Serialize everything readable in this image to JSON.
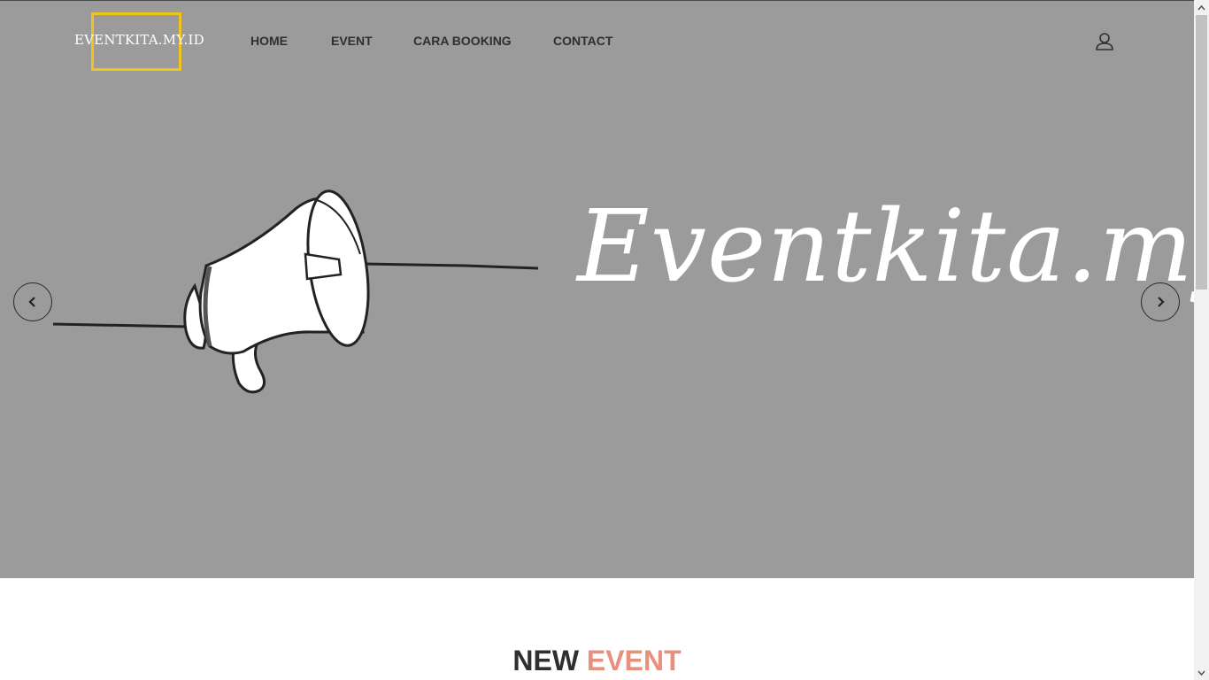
{
  "header": {
    "logo_text": "EVENTKITA.MY.ID",
    "nav": [
      {
        "label": "HOME"
      },
      {
        "label": "EVENT"
      },
      {
        "label": "CARA BOOKING"
      },
      {
        "label": "CONTACT"
      }
    ],
    "user_icon": "user-icon"
  },
  "hero": {
    "title": "Eventkita.my.id",
    "prev_icon": "chevron-left-icon",
    "next_icon": "chevron-right-icon",
    "illustration": "megaphone-icon"
  },
  "section": {
    "title_part1": "NEW",
    "title_part2": "EVENT"
  },
  "colors": {
    "hero_bg": "#9b9b9b",
    "logo_box": "#f0c419",
    "accent": "#e8907c",
    "nav_text": "#2f2f2f"
  }
}
